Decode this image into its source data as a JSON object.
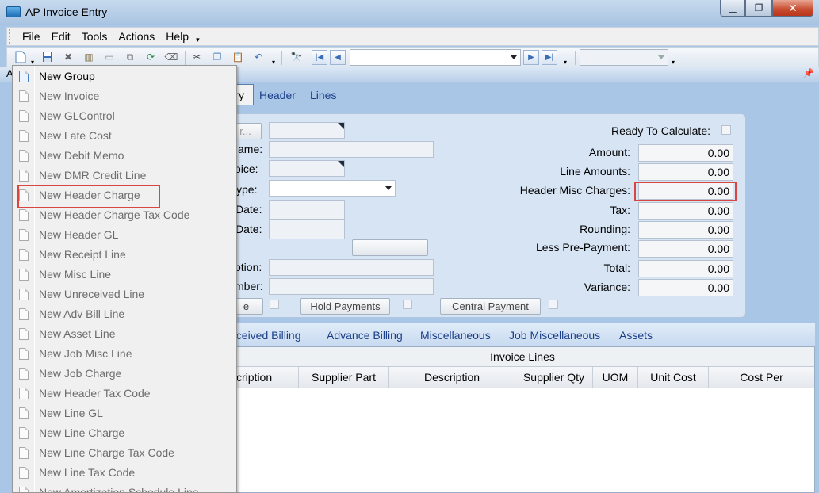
{
  "window": {
    "title": "AP Invoice Entry",
    "min_glyph": "▁",
    "max_glyph": "❐",
    "close_glyph": "✕"
  },
  "menubar": {
    "items": [
      "File",
      "Edit",
      "Tools",
      "Actions",
      "Help"
    ],
    "more_glyph": "▾"
  },
  "toolbar": {
    "icons": [
      "new-document-icon",
      "save-icon",
      "delete-icon",
      "book-icon",
      "print-icon",
      "attach-icon",
      "refresh-icon",
      "clear-icon",
      "cut-icon",
      "copy-icon",
      "paste-icon",
      "undo-icon",
      "find-icon",
      "first-record-icon",
      "previous-record-icon",
      "next-record-icon",
      "last-record-icon"
    ],
    "record_combo_value": "",
    "second_combo_value": ""
  },
  "panel": {
    "left_letter": "A",
    "pin_glyph": "📌"
  },
  "tabs": {
    "active_partial": "ry",
    "items": [
      "Header",
      "Lines"
    ]
  },
  "form": {
    "left_labels": [
      "ame:",
      "oice:",
      "ype:",
      "Date:",
      "Date:",
      "ption:",
      "mber:"
    ],
    "buttons": {
      "partial": "r...",
      "partial_bottom": "e",
      "hold": "Hold Payments",
      "central": "Central Payment",
      "blank": ""
    },
    "ready_label": "Ready To Calculate:",
    "totals": [
      {
        "label": "Amount:",
        "value": "0.00"
      },
      {
        "label": "Line Amounts:",
        "value": "0.00"
      },
      {
        "label": "Header Misc Charges:",
        "value": "0.00"
      },
      {
        "label": "Tax:",
        "value": "0.00"
      },
      {
        "label": "Rounding:",
        "value": "0.00"
      },
      {
        "label": "Less Pre-Payment:",
        "value": "0.00"
      },
      {
        "label": "Total:",
        "value": "0.00"
      },
      {
        "label": "Variance:",
        "value": "0.00"
      }
    ]
  },
  "lower_tabs": [
    "eceived Billing",
    "Advance Billing",
    "Miscellaneous",
    "Job Miscellaneous",
    "Assets"
  ],
  "grid": {
    "caption": "Invoice Lines",
    "columns": [
      "scription",
      "Supplier Part",
      "Description",
      "Supplier Qty",
      "UOM",
      "Unit Cost",
      "Cost Per"
    ]
  },
  "dropdown": {
    "items": [
      "New Group",
      "New Invoice",
      "New GLControl",
      "New Late Cost",
      "New Debit Memo",
      "New DMR Credit Line",
      "New Header Charge",
      "New Header Charge Tax Code",
      "New Header GL",
      "New Receipt Line",
      "New Misc Line",
      "New Unreceived Line",
      "New Adv Bill Line",
      "New Asset Line",
      "New Job Misc Line",
      "New Job Charge",
      "New Header Tax Code",
      "New Line GL",
      "New Line Charge",
      "New Line Charge Tax Code",
      "New Line Tax Code",
      "New Amortization Schedule Line"
    ],
    "enabled_index": 0,
    "highlighted_index": 6
  },
  "highlight_color": "#d9463f"
}
